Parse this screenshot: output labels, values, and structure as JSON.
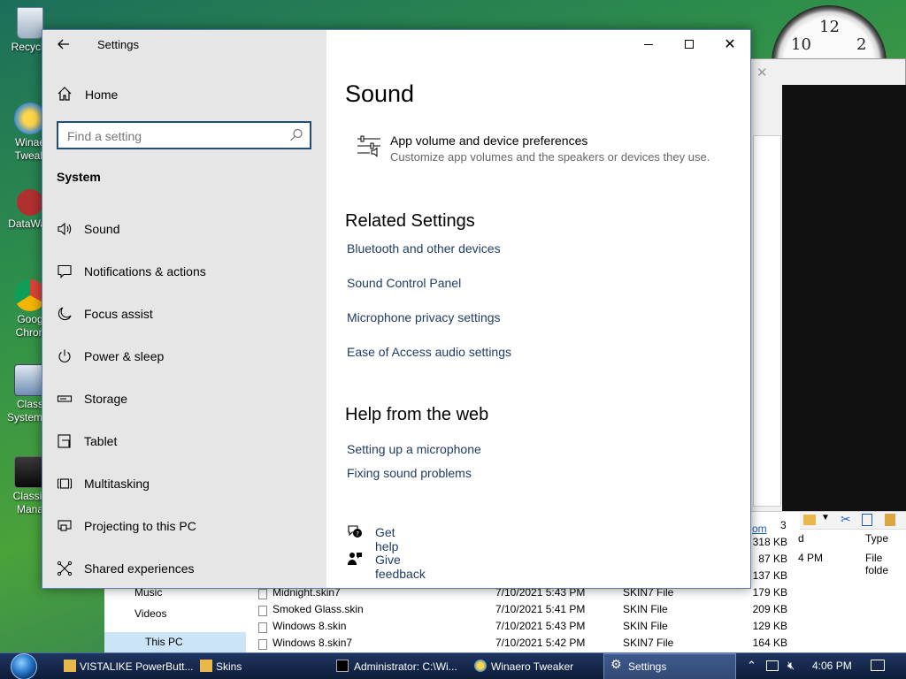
{
  "desktop": {
    "icons": [
      {
        "label": "Recycle"
      },
      {
        "label": "Winae Tweak"
      },
      {
        "label": "DataWag"
      },
      {
        "label": "Goog Chron"
      },
      {
        "label": "Class System C"
      },
      {
        "label": "Classic Mana"
      }
    ],
    "clock": {
      "n10": "10",
      "n12": "12",
      "n2": "2"
    }
  },
  "settings": {
    "title": "Settings",
    "home_label": "Home",
    "search_placeholder": "Find a setting",
    "section_title": "System",
    "nav": [
      {
        "label": "Sound",
        "icon": "speaker-icon"
      },
      {
        "label": "Notifications & actions",
        "icon": "notification-icon"
      },
      {
        "label": "Focus assist",
        "icon": "moon-icon"
      },
      {
        "label": "Power & sleep",
        "icon": "power-icon"
      },
      {
        "label": "Storage",
        "icon": "storage-icon"
      },
      {
        "label": "Tablet",
        "icon": "tablet-icon"
      },
      {
        "label": "Multitasking",
        "icon": "multitasking-icon"
      },
      {
        "label": "Projecting to this PC",
        "icon": "projecting-icon"
      },
      {
        "label": "Shared experiences",
        "icon": "shared-icon"
      }
    ],
    "page_title": "Sound",
    "pref_title": "App volume and device preferences",
    "pref_desc": "Customize app volumes and the speakers or devices they use.",
    "related_title": "Related Settings",
    "related_links": [
      "Bluetooth and other devices",
      "Sound Control Panel",
      "Microphone privacy settings",
      "Ease of Access audio settings"
    ],
    "help_title": "Help from the web",
    "help_links": [
      "Setting up a microphone",
      "Fixing sound problems"
    ],
    "get_help": "Get help",
    "give_feedback": "Give feedback"
  },
  "explorer": {
    "nav": [
      "Music",
      "Videos",
      "This PC"
    ],
    "files": [
      {
        "name": "Midnight.skin7",
        "date": "7/10/2021 5:43 PM",
        "type": "SKIN7 File",
        "size": "179 KB"
      },
      {
        "name": "Smoked Glass.skin",
        "date": "7/10/2021 5:41 PM",
        "type": "SKIN File",
        "size": "209 KB"
      },
      {
        "name": "Windows 8.skin",
        "date": "7/10/2021 5:43 PM",
        "type": "SKIN File",
        "size": "129 KB"
      },
      {
        "name": "Windows 8.skin7",
        "date": "7/10/2021 5:42 PM",
        "type": "SKIN7 File",
        "size": "164 KB"
      }
    ],
    "sizes_above": [
      "318 KB",
      "87 KB",
      "137 KB"
    ],
    "col_d": "d",
    "col_type": "Type",
    "pm_value": "4 PM",
    "type_value": "File folde",
    "partial_link": "om",
    "partial_num": "3"
  },
  "taskbar": {
    "items": [
      {
        "label": "VISTALIKE PowerButt..."
      },
      {
        "label": "Skins"
      },
      {
        "label": "Administrator: C:\\Wi..."
      },
      {
        "label": "Winaero Tweaker"
      },
      {
        "label": "Settings"
      }
    ],
    "time": "4:06 PM"
  },
  "colors": {
    "accent": "#1f4e79",
    "link": "#1f3c64",
    "sidebar": "#e6e6e6"
  }
}
